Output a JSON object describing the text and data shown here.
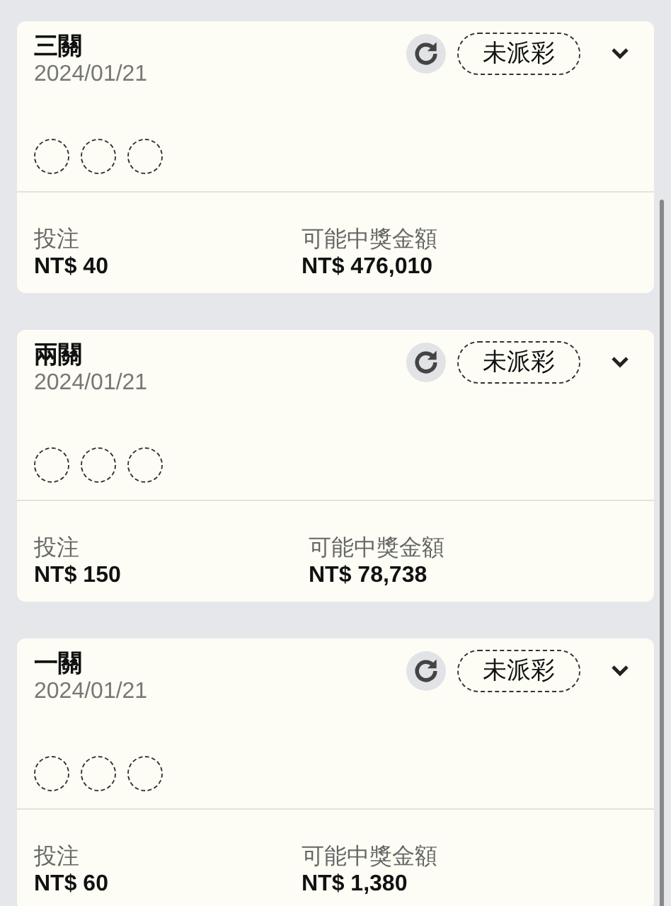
{
  "bets": [
    {
      "title": "三關",
      "date": "2024/01/21",
      "status": "未派彩",
      "picks": [
        {
          "kind": "empty"
        },
        {
          "kind": "empty"
        },
        {
          "kind": "empty"
        }
      ],
      "stake_label": "投注",
      "stake": "NT$ 40",
      "payout_label": "可能中獎金額",
      "payout": "NT$ 476,010",
      "expanded": false
    },
    {
      "title": "兩關",
      "date": "2024/01/21",
      "status": "未派彩",
      "picks": [
        {
          "kind": "empty"
        },
        {
          "kind": "empty"
        },
        {
          "kind": "empty"
        }
      ],
      "stake_label": "投注",
      "stake": "NT$ 150",
      "payout_label": "可能中獎金額",
      "payout": "NT$ 78,738",
      "expanded": false
    },
    {
      "title": "一關",
      "date": "2024/01/21",
      "status": "未派彩",
      "picks": [
        {
          "kind": "empty"
        },
        {
          "kind": "empty"
        },
        {
          "kind": "empty"
        }
      ],
      "stake_label": "投注",
      "stake": "NT$ 60",
      "payout_label": "可能中獎金額",
      "payout": "NT$ 1,380",
      "expanded": false
    }
  ]
}
